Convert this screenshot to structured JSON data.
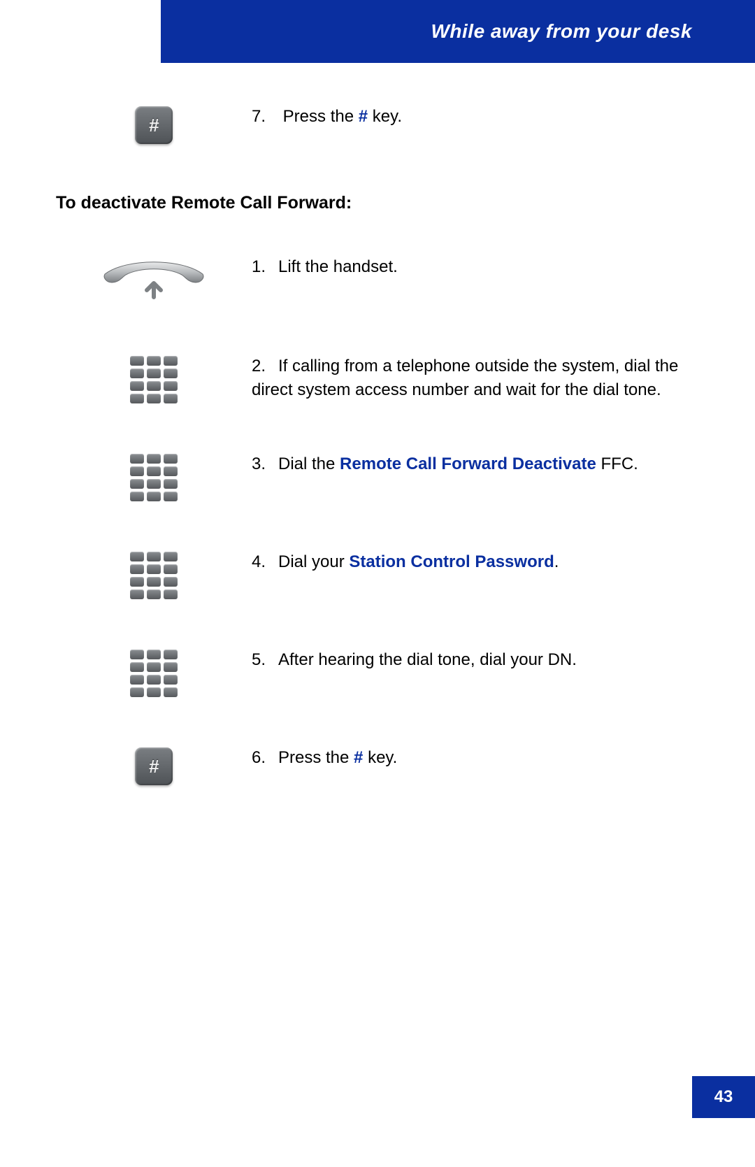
{
  "header": {
    "title": "While away from your desk"
  },
  "top_step": {
    "number": "7.",
    "text_before": "Press the ",
    "hash": "#",
    "text_after": " key."
  },
  "section_heading": "To deactivate Remote Call Forward:",
  "steps": [
    {
      "icon": "handset",
      "number": "1.",
      "segments": [
        {
          "t": "Lift the handset."
        }
      ]
    },
    {
      "icon": "keypad",
      "number": "2.",
      "segments": [
        {
          "t": "If calling from a telephone outside the system, dial the direct system access number and wait for the dial tone."
        }
      ]
    },
    {
      "icon": "keypad",
      "number": "3.",
      "segments": [
        {
          "t": "Dial the "
        },
        {
          "t": "Remote Call Forward Deactivate",
          "hl": true
        },
        {
          "t": " FFC."
        }
      ]
    },
    {
      "icon": "keypad",
      "number": "4.",
      "segments": [
        {
          "t": "Dial your "
        },
        {
          "t": "Station Control Password",
          "hl": true
        },
        {
          "t": "."
        }
      ]
    },
    {
      "icon": "keypad",
      "number": "5.",
      "segments": [
        {
          "t": "After hearing the dial tone, dial your DN."
        }
      ]
    },
    {
      "icon": "hash",
      "number": "6.",
      "segments": [
        {
          "t": "Press the "
        },
        {
          "t": "#",
          "hl": true
        },
        {
          "t": " key."
        }
      ]
    }
  ],
  "page_number": "43"
}
